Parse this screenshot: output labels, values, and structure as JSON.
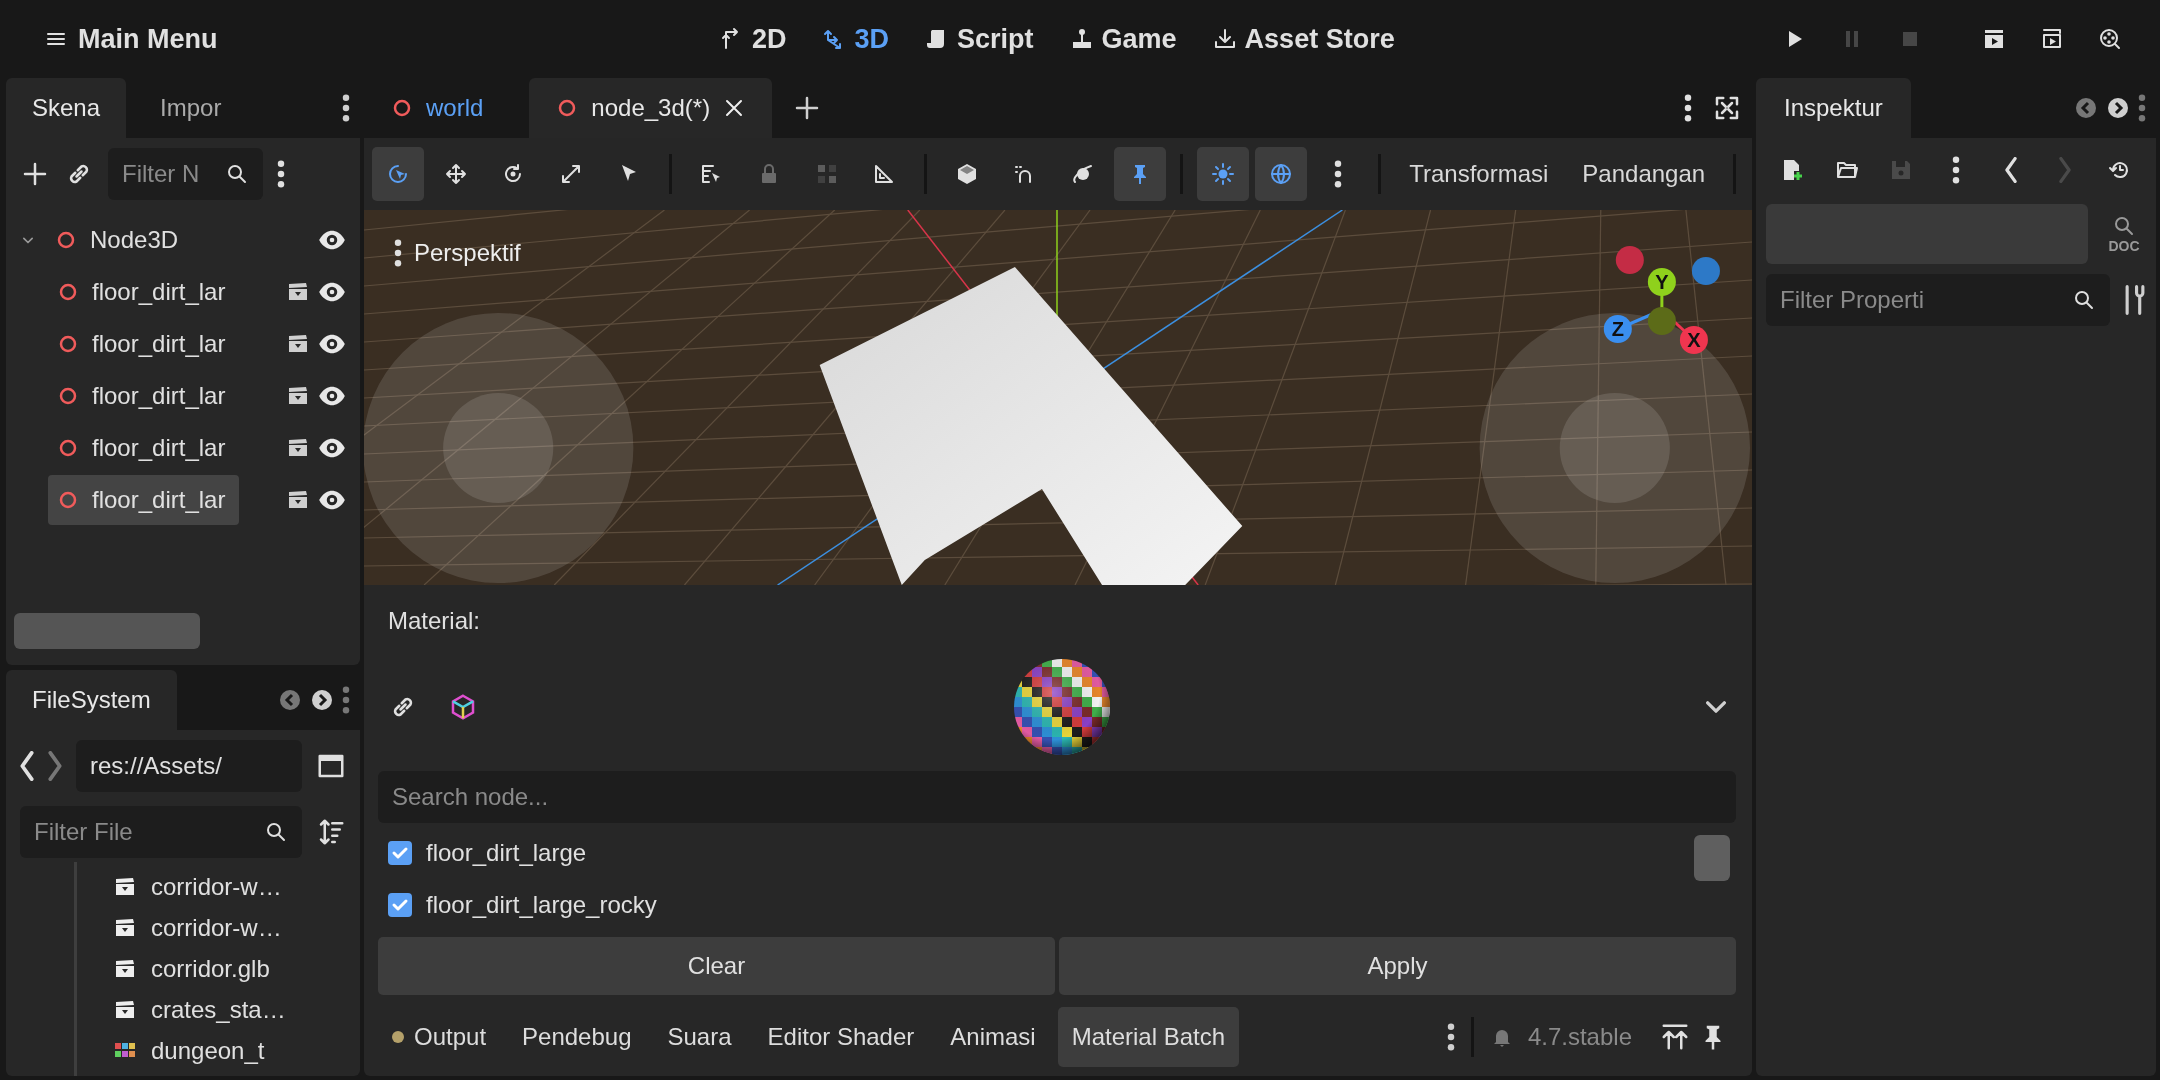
{
  "main_menu": {
    "label": "Main Menu"
  },
  "workspaces": [
    {
      "label": "2D",
      "selected": false
    },
    {
      "label": "3D",
      "selected": true
    },
    {
      "label": "Script",
      "selected": false
    },
    {
      "label": "Game",
      "selected": false
    },
    {
      "label": "Asset Store",
      "selected": false
    }
  ],
  "run_buttons": [
    {
      "disabled": false
    },
    {
      "disabled": true
    },
    {
      "disabled": true
    },
    {
      "disabled": false
    },
    {
      "disabled": false
    },
    {
      "disabled": false
    }
  ],
  "scene_dock": {
    "tabs": [
      {
        "label": "Skena",
        "selected": true
      },
      {
        "label": "Impor",
        "selected": false
      }
    ],
    "filter_placeholder": "Filter N",
    "tree": [
      {
        "label": "Node3D",
        "expanded": true,
        "selected": false,
        "visible": true,
        "children": [
          {
            "label": "floor_dirt_lar",
            "selected": false,
            "visible": true
          },
          {
            "label": "floor_dirt_lar",
            "selected": false,
            "visible": true
          },
          {
            "label": "floor_dirt_lar",
            "selected": false,
            "visible": true
          },
          {
            "label": "floor_dirt_lar",
            "selected": false,
            "visible": true
          },
          {
            "label": "floor_dirt_lar",
            "selected": true,
            "visible": true
          }
        ]
      }
    ]
  },
  "filesystem": {
    "tab": "FileSystem",
    "path": "res://Assets/",
    "filter_placeholder": "Filter File",
    "items": [
      {
        "label": "corridor-w…",
        "kind": "scene"
      },
      {
        "label": "corridor-w…",
        "kind": "scene"
      },
      {
        "label": "corridor.glb",
        "kind": "scene"
      },
      {
        "label": "crates_sta…",
        "kind": "scene"
      },
      {
        "label": "dungeon_t",
        "kind": "texture"
      }
    ]
  },
  "editor_tabs": [
    {
      "label": "world",
      "selected": false
    },
    {
      "label": "node_3d(*)",
      "selected": true
    }
  ],
  "toolbar": {
    "tools": [
      {
        "selected": true,
        "disabled": false
      },
      {
        "selected": false,
        "disabled": false
      },
      {
        "selected": false,
        "disabled": false
      },
      {
        "selected": false,
        "disabled": false
      },
      {
        "selected": false,
        "disabled": false
      },
      {
        "selected": false,
        "disabled": false
      },
      {
        "selected": false,
        "disabled": true
      },
      {
        "selected": false,
        "disabled": true
      },
      {
        "selected": false,
        "disabled": false
      },
      {
        "selected": false,
        "disabled": false
      },
      {
        "selected": false,
        "disabled": false
      },
      {
        "selected": false,
        "disabled": false
      },
      {
        "selected": true,
        "disabled": false
      },
      {
        "selected": true,
        "disabled": false
      },
      {
        "selected": true,
        "disabled": false
      },
      {
        "selected": false,
        "disabled": false
      }
    ],
    "menus": [
      "Transformasi",
      "Pandangan"
    ]
  },
  "viewport": {
    "view_label": "Perspektif",
    "gizmo": [
      {
        "color": "#c42c45"
      },
      {
        "label": "Y",
        "color": "#8fd11c"
      },
      {
        "color": "#2d79c7"
      },
      {
        "label": "Z",
        "color": "#3a8ff0"
      },
      {
        "color": "#5c6b18"
      },
      {
        "label": "X",
        "color": "#f0354f"
      }
    ]
  },
  "material_batch": {
    "label": "Material:",
    "search_placeholder": "Search node...",
    "nodes": [
      {
        "label": "floor_dirt_large",
        "checked": true
      },
      {
        "label": "floor_dirt_large_rocky",
        "checked": true
      }
    ],
    "buttons": [
      "Clear",
      "Apply"
    ]
  },
  "bottom_tabs": [
    {
      "label": "Output",
      "selected": false,
      "indicator": true
    },
    {
      "label": "Pendebug",
      "selected": false,
      "indicator": false
    },
    {
      "label": "Suara",
      "selected": false,
      "indicator": false
    },
    {
      "label": "Editor Shader",
      "selected": false,
      "indicator": false
    },
    {
      "label": "Animasi",
      "selected": false,
      "indicator": false
    },
    {
      "label": "Material Batch",
      "selected": true,
      "indicator": false
    }
  ],
  "version": "4.7.stable",
  "inspector": {
    "tab": "Inspektur",
    "tools": [
      {
        "disabled": false
      },
      {
        "disabled": false
      },
      {
        "disabled": true
      },
      {
        "disabled": false
      },
      {
        "disabled": false
      },
      {
        "disabled": true
      },
      {
        "disabled": false
      }
    ],
    "doc_label": "DOC",
    "filter_placeholder": "Filter Properti"
  }
}
